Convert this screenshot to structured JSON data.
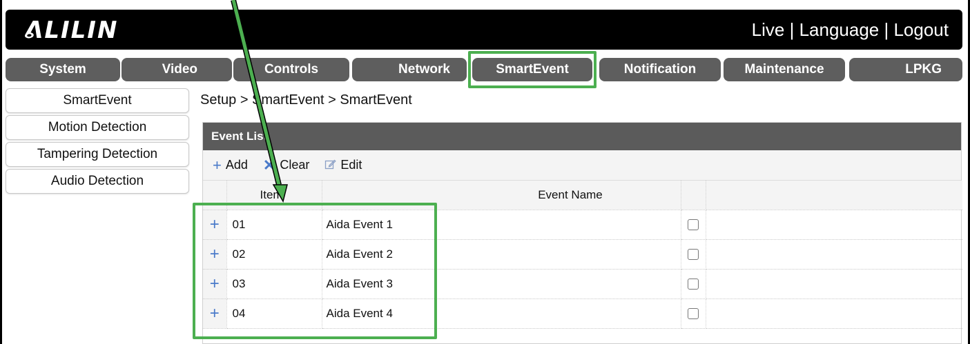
{
  "header": {
    "logo": "ᕕLILIN",
    "links": [
      "Live",
      "Language",
      "Logout"
    ],
    "separator": " | "
  },
  "nav": {
    "tabs": [
      {
        "label": "System",
        "active": false
      },
      {
        "label": "Video",
        "active": false
      },
      {
        "label": "Controls",
        "active": false
      },
      {
        "label": "Network",
        "active": false
      },
      {
        "label": "SmartEvent",
        "active": true
      },
      {
        "label": "Notification",
        "active": false
      },
      {
        "label": "Maintenance",
        "active": false
      },
      {
        "label": "LPKG",
        "active": false
      }
    ]
  },
  "sidebar": {
    "items": [
      {
        "label": "SmartEvent"
      },
      {
        "label": "Motion Detection"
      },
      {
        "label": "Tampering Detection"
      },
      {
        "label": "Audio Detection"
      }
    ]
  },
  "breadcrumb": "Setup > SmartEvent > SmartEvent",
  "event_list": {
    "title": "Event List",
    "toolbar": {
      "add": "Add",
      "clear": "Clear",
      "edit": "Edit"
    },
    "columns": {
      "item": "Item",
      "event_name": "Event Name"
    },
    "rows": [
      {
        "item": "01",
        "name": "Aida Event 1",
        "checked": false
      },
      {
        "item": "02",
        "name": "Aida Event 2",
        "checked": false
      },
      {
        "item": "03",
        "name": "Aida Event 3",
        "checked": false
      },
      {
        "item": "04",
        "name": "Aida Event 4",
        "checked": false
      }
    ]
  },
  "colors": {
    "accent_green": "#4caf50",
    "tab_bg": "#5e5e5e",
    "header_bg": "#000000",
    "icon_blue": "#4a7ac9"
  }
}
